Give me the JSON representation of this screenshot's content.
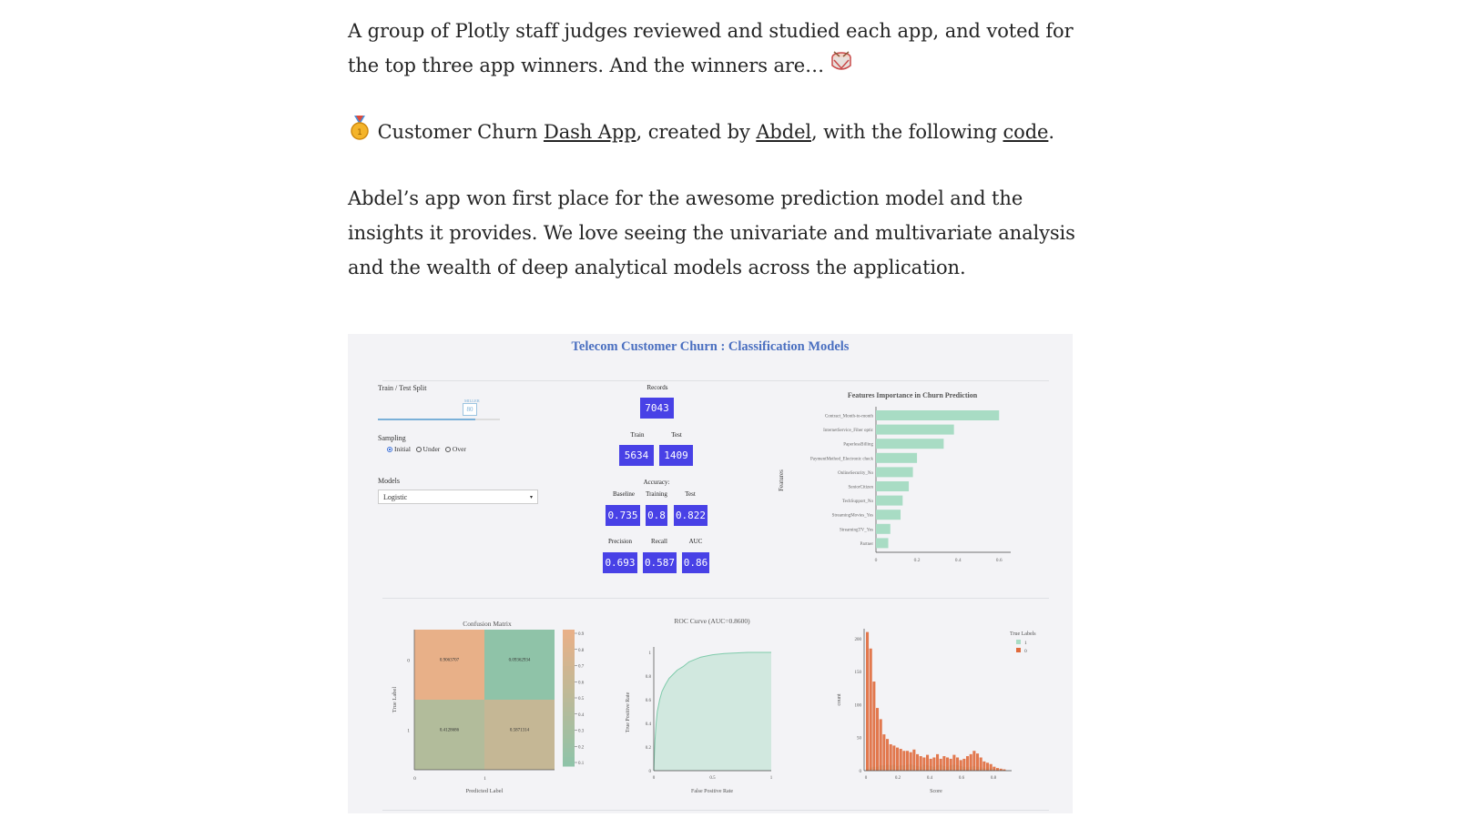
{
  "article": {
    "p1": "A group of Plotly staff judges reviewed and studied each app, and voted for the top three app winners. And the winners are… ",
    "p2_pre": " Customer Churn ",
    "p2_link1": "Dash App",
    "p2_mid1": ", created by ",
    "p2_link2": "Abdel",
    "p2_mid2": ", with the following ",
    "p2_link3": "code",
    "p2_end": ".",
    "p3": "Abdel’s app won first place for the awesome prediction model and the insights it provides. We love seeing the univariate and multivariate analysis and the wealth of deep analytical models across the application.",
    "emoji_drum": "drum-emoji",
    "emoji_medal": "gold-medal-emoji"
  },
  "app": {
    "title": "Telecom Customer Churn : Classification Models",
    "split_label": "Train / Test Split",
    "split_value": "80",
    "split_hint": "MILLER",
    "split_fraction": 0.8,
    "sampling_label": "Sampling",
    "sampling_options": [
      "Initial",
      "Under",
      "Over"
    ],
    "sampling_selected": "Initial",
    "models_label": "Models",
    "models_value": "Logistic",
    "records_label": "Records",
    "records": "7043",
    "train_label": "Train",
    "train": "5634",
    "test_label": "Test",
    "test": "1409",
    "accuracy_label": "Accuracy:",
    "baseline_label": "Baseline",
    "training_label": "Training",
    "test2_label": "Test",
    "baseline": "0.735",
    "training": "0.8",
    "test_acc": "0.822",
    "precision_label": "Precision",
    "recall_label": "Recall",
    "auc_label": "AUC",
    "precision": "0.693",
    "recall": "0.587",
    "auc": "0.86"
  },
  "chart_data": [
    {
      "type": "bar",
      "title": "Features Importance in Churn Prediction",
      "ylabel": "Features",
      "xlabel": "",
      "orientation": "horizontal",
      "categories": [
        "Contract_Month-to-month",
        "InternetService_Fiber optic",
        "PaperlessBilling",
        "PaymentMethod_Electronic check",
        "OnlineSecurity_No",
        "SeniorCitizen",
        "TechSupport_No",
        "StreamingMovies_Yes",
        "StreamingTV_Yes",
        "Partner"
      ],
      "values": [
        0.6,
        0.38,
        0.33,
        0.2,
        0.18,
        0.16,
        0.13,
        0.12,
        0.07,
        0.06
      ],
      "xticks": [
        "0",
        "0.2",
        "0.4",
        "0.6"
      ],
      "xlim": [
        0,
        0.63
      ],
      "color": "#a8dcc4"
    },
    {
      "type": "heatmap",
      "title": "Confusion Matrix",
      "xlabel": "Predicted Label",
      "ylabel": "True Label",
      "x": [
        "0",
        "1"
      ],
      "y": [
        "0",
        "1"
      ],
      "z": [
        [
          0.9063707,
          0.09362934
        ],
        [
          0.4128686,
          0.5871314
        ]
      ],
      "z_labels": [
        [
          "0.9063707",
          "0.09362934"
        ],
        [
          "0.4128686",
          "0.5871314"
        ]
      ],
      "colorbar_ticks": [
        "0.9",
        "0.8",
        "0.7",
        "0.6",
        "0.5",
        "0.4",
        "0.3",
        "0.2",
        "0.1"
      ],
      "colors": {
        "low": "#8fc3a8",
        "high": "#e8b088"
      }
    },
    {
      "type": "area",
      "title": "ROC Curve (AUC=0.8600)",
      "xlabel": "False Positive Rate",
      "ylabel": "True Positive Rate",
      "x": [
        0,
        0.01,
        0.02,
        0.03,
        0.05,
        0.07,
        0.1,
        0.13,
        0.17,
        0.2,
        0.25,
        0.3,
        0.35,
        0.4,
        0.5,
        0.6,
        0.7,
        0.8,
        0.9,
        1
      ],
      "y": [
        0,
        0.25,
        0.4,
        0.5,
        0.6,
        0.67,
        0.73,
        0.78,
        0.82,
        0.85,
        0.88,
        0.92,
        0.94,
        0.96,
        0.98,
        0.99,
        0.995,
        1,
        1,
        1
      ],
      "xticks": [
        "0",
        "0.5",
        "1"
      ],
      "yticks": [
        "0",
        "0.2",
        "0.4",
        "0.6",
        "0.8",
        "1"
      ],
      "color": "#a8dcc4"
    },
    {
      "type": "bar",
      "title": "",
      "xlabel": "Score",
      "ylabel": "count",
      "legend_title": "True Labels",
      "legend_position": "top-right",
      "series": [
        {
          "name": "1",
          "color": "#a8dcc4",
          "values": [
            3,
            5,
            6,
            6,
            8,
            8,
            9,
            8,
            9,
            7,
            8,
            8,
            9,
            10,
            8,
            7,
            6,
            9,
            8,
            7,
            6,
            8,
            9,
            7,
            6,
            8,
            9,
            8,
            7,
            6,
            5,
            6,
            7,
            6,
            5,
            4,
            5,
            4,
            3,
            2,
            2,
            1
          ]
        },
        {
          "name": "0",
          "color": "#e06a3c",
          "values": [
            210,
            185,
            135,
            95,
            78,
            55,
            48,
            40,
            38,
            35,
            33,
            30,
            30,
            28,
            32,
            25,
            22,
            20,
            24,
            18,
            20,
            25,
            18,
            22,
            20,
            18,
            24,
            20,
            16,
            18,
            22,
            25,
            30,
            26,
            20,
            14,
            12,
            10,
            6,
            4,
            3,
            2
          ]
        }
      ],
      "xticks": [
        "0",
        "0.2",
        "0.4",
        "0.6",
        "0.8"
      ],
      "yticks": [
        "0",
        "50",
        "100",
        "150",
        "200"
      ],
      "xlim": [
        0,
        0.88
      ],
      "ylim": [
        0,
        215
      ]
    }
  ]
}
